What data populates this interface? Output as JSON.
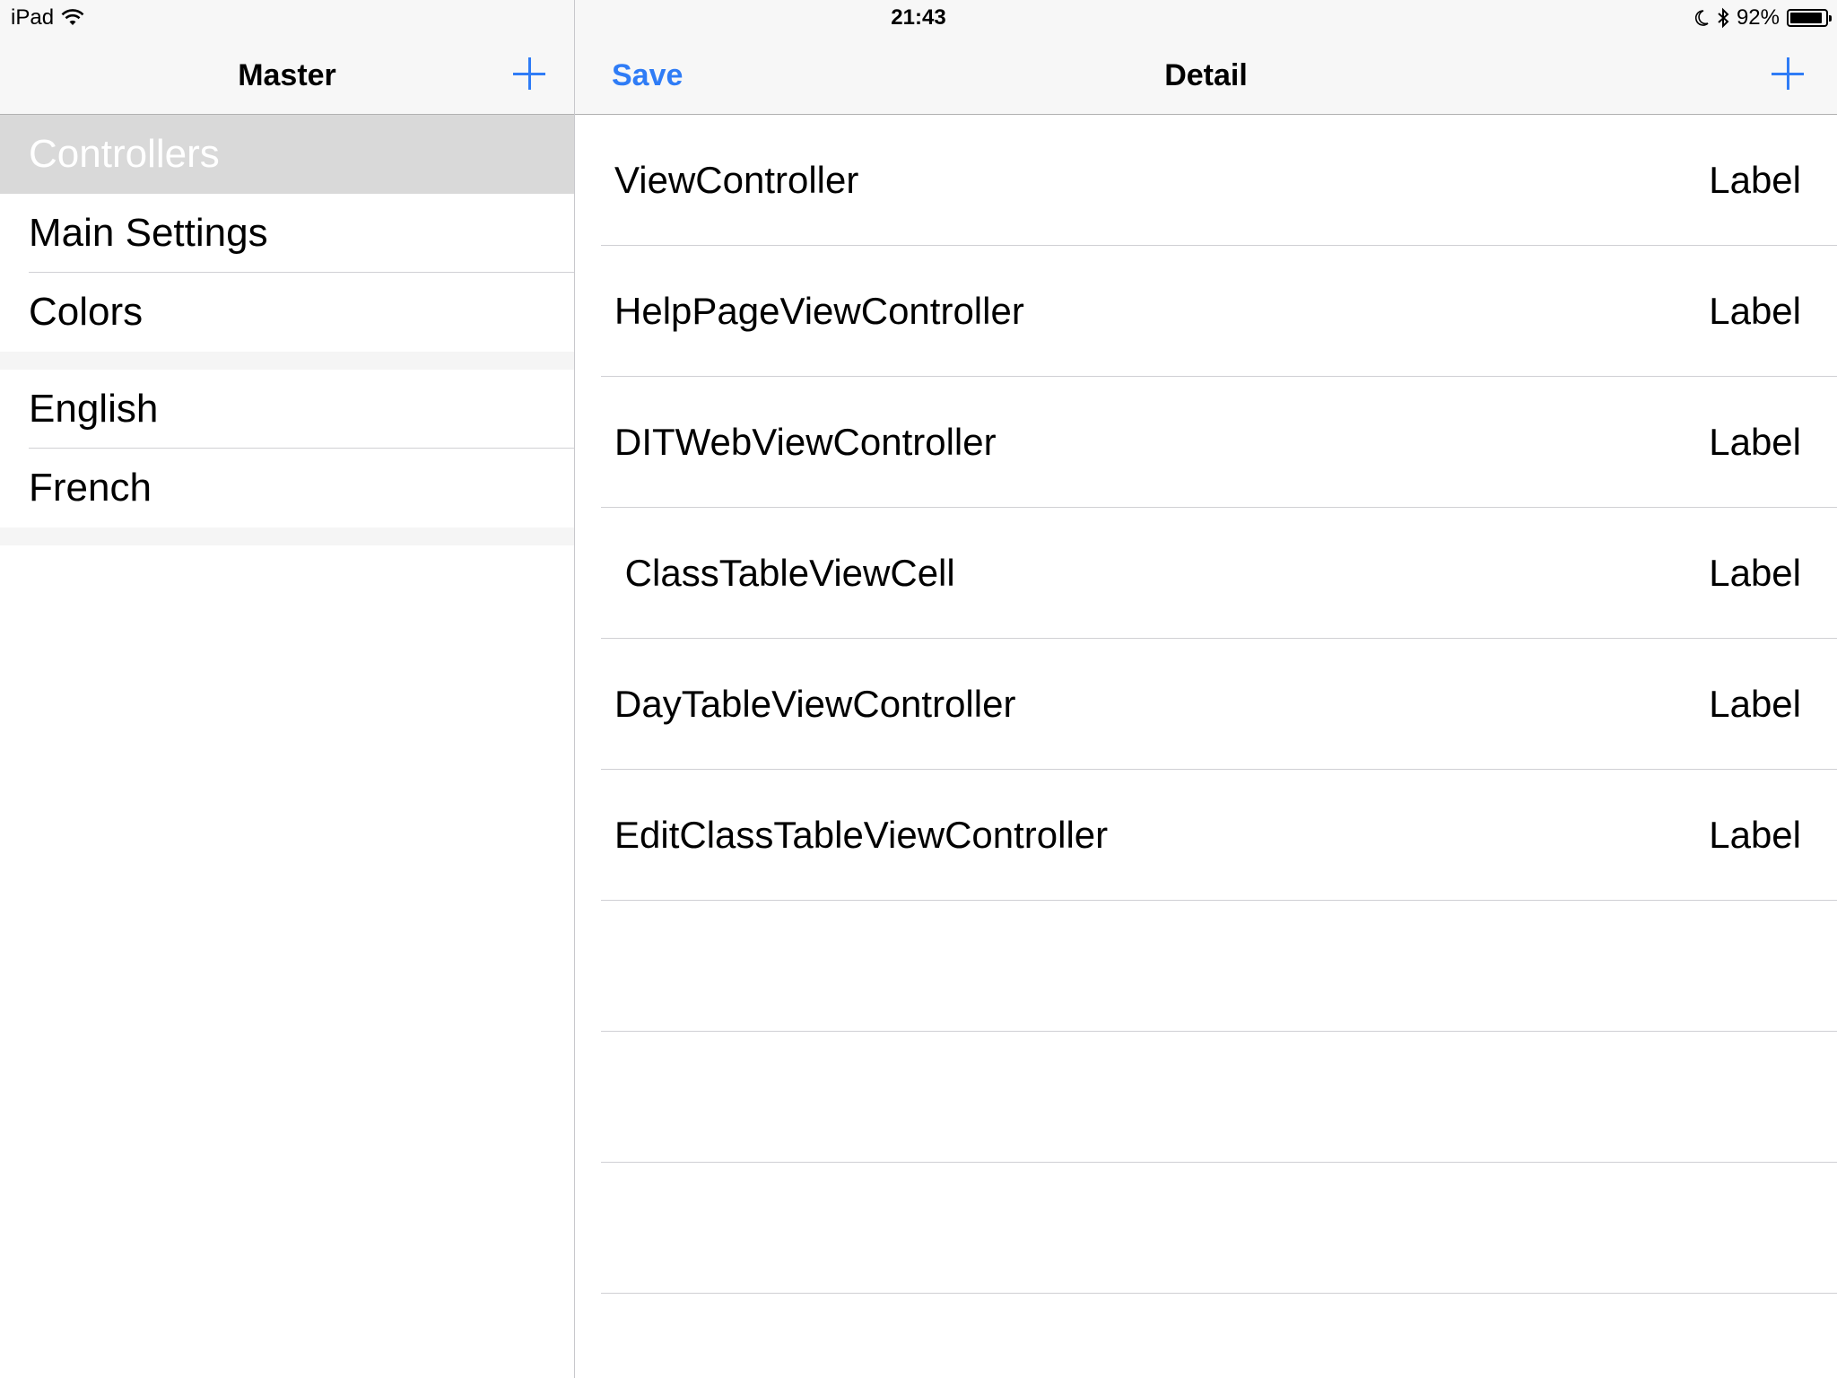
{
  "status_bar": {
    "device": "iPad",
    "time": "21:43",
    "battery_percent_text": "92%",
    "battery_level": 0.92
  },
  "master": {
    "title": "Master",
    "sections": [
      {
        "items": [
          "Controllers",
          "Main Settings",
          "Colors"
        ]
      },
      {
        "items": [
          "English",
          "French"
        ]
      }
    ],
    "selected": "Controllers"
  },
  "detail": {
    "title": "Detail",
    "save_label": "Save",
    "rows": [
      {
        "name": "ViewController",
        "value": "Label"
      },
      {
        "name": "HelpPageViewController",
        "value": "Label"
      },
      {
        "name": "DITWebViewController",
        "value": "Label"
      },
      {
        "name": " ClassTableViewCell",
        "value": "Label"
      },
      {
        "name": "DayTableViewController",
        "value": "Label"
      },
      {
        "name": "EditClassTableViewController",
        "value": "Label"
      }
    ],
    "empty_rows": 3
  },
  "colors": {
    "accent": "#2f7cf6",
    "bar_background": "#f7f7f7",
    "selected_row": "#d9d9d9"
  },
  "icons": [
    "wifi-icon",
    "moon-icon",
    "bluetooth-icon",
    "battery-icon",
    "plus-icon"
  ]
}
